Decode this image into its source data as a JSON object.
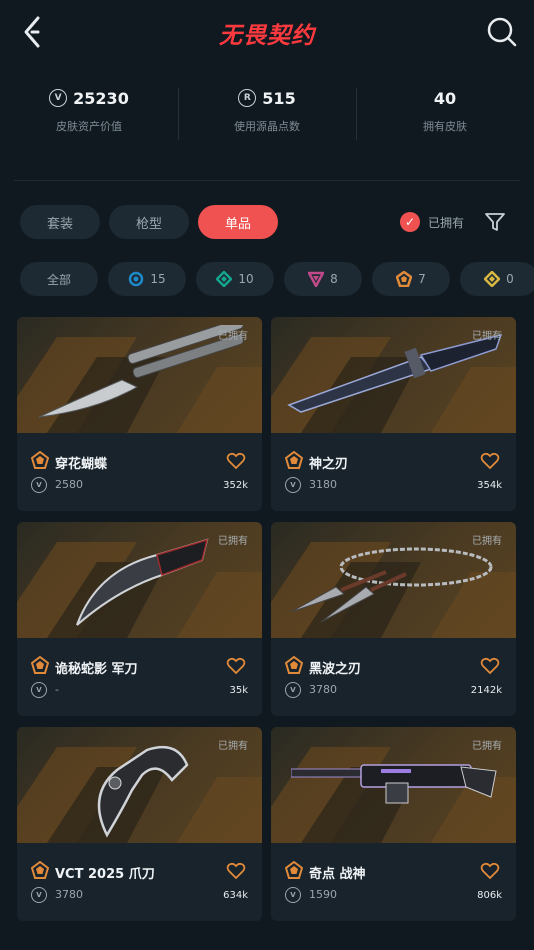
{
  "header": {
    "title": "无畏契约",
    "back_icon": "chevron-left-icon",
    "search_icon": "search-icon"
  },
  "stats": [
    {
      "value": "25230",
      "label": "皮肤资产价值",
      "icon": "vp-coin-icon"
    },
    {
      "value": "515",
      "label": "使用源晶点数",
      "icon": "radianite-icon"
    },
    {
      "value": "40",
      "label": "拥有皮肤",
      "icon": ""
    }
  ],
  "tabs": [
    {
      "label": "套装",
      "active": false
    },
    {
      "label": "枪型",
      "active": false
    },
    {
      "label": "单品",
      "active": true
    }
  ],
  "owned_filter": {
    "label": "已拥有",
    "checked": true
  },
  "chips": [
    {
      "label": "全部",
      "count": "",
      "color": ""
    },
    {
      "label": "",
      "count": "15",
      "color": "#1e88c8"
    },
    {
      "label": "",
      "count": "10",
      "color": "#14a58c"
    },
    {
      "label": "",
      "count": "8",
      "color": "#c24a8a"
    },
    {
      "label": "",
      "count": "7",
      "color": "#e08a3a"
    },
    {
      "label": "",
      "count": "0",
      "color": "#d9b840"
    }
  ],
  "cards": [
    {
      "name": "穿花蝴蝶",
      "price": "2580",
      "likes": "352k",
      "owned": "已拥有"
    },
    {
      "name": "神之刃",
      "price": "3180",
      "likes": "354k",
      "owned": "已拥有"
    },
    {
      "name": "诡秘蛇影 军刀",
      "price": "-",
      "likes": "35k",
      "owned": "已拥有"
    },
    {
      "name": "黑波之刃",
      "price": "3780",
      "likes": "2142k",
      "owned": "已拥有"
    },
    {
      "name": "VCT 2025 爪刀",
      "price": "3780",
      "likes": "634k",
      "owned": "已拥有"
    },
    {
      "name": "奇点 战神",
      "price": "1590",
      "likes": "806k",
      "owned": "已拥有"
    }
  ],
  "colors": {
    "accent": "#f05252",
    "tier": "#e08a3a",
    "background": "#101920"
  }
}
